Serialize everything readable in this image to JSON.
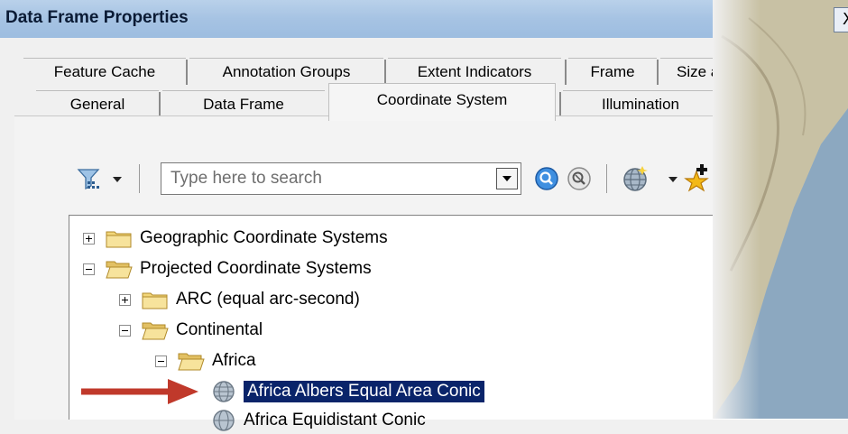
{
  "window": {
    "title": "Data Frame Properties",
    "close_label": "X"
  },
  "tabs": {
    "row1": [
      "Feature Cache",
      "Annotation Groups",
      "Extent Indicators",
      "Frame",
      "Size and"
    ],
    "row2": [
      "General",
      "Data Frame",
      "Coordinate System",
      "Illumination"
    ],
    "active": "Coordinate System"
  },
  "toolbar": {
    "search_placeholder": "Type here to search",
    "icons": [
      "filter-icon",
      "dropdown-arrow-icon",
      "search-icon",
      "clear-search-icon",
      "globe-icon",
      "add-favorite-icon"
    ]
  },
  "tree": {
    "items": [
      {
        "label": "Geographic Coordinate Systems",
        "expanded": false,
        "type": "folder"
      },
      {
        "label": "Projected Coordinate Systems",
        "expanded": true,
        "type": "folder"
      },
      {
        "label": "ARC (equal arc-second)",
        "expanded": false,
        "type": "folder"
      },
      {
        "label": "Continental",
        "expanded": true,
        "type": "folder"
      },
      {
        "label": "Africa",
        "expanded": true,
        "type": "folder"
      },
      {
        "label": "Africa Albers Equal Area Conic",
        "type": "projection",
        "selected": true
      },
      {
        "label": "Africa Equidistant Conic",
        "type": "projection"
      }
    ]
  },
  "colors": {
    "selection": "#0a246a",
    "arrow": "#c0392b",
    "folder": "#f2d679"
  }
}
